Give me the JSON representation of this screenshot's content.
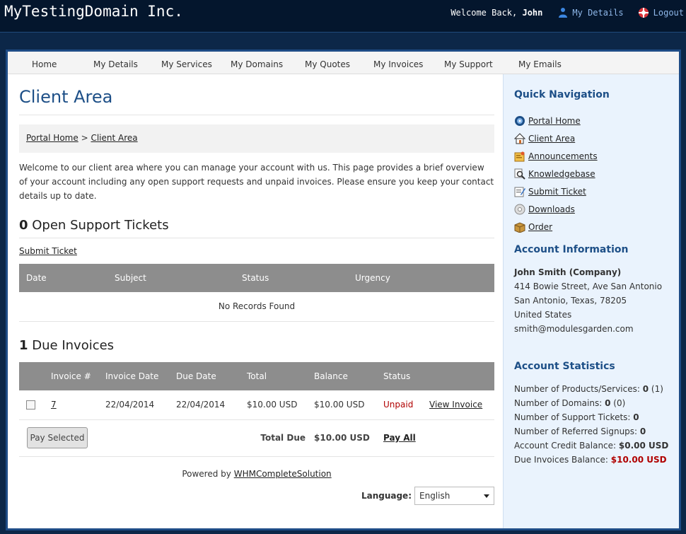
{
  "header": {
    "brand": "MyTestingDomain Inc.",
    "welcome_prefix": "Welcome Back, ",
    "welcome_name": "John",
    "my_details": "My Details",
    "logout": "Logout"
  },
  "nav": [
    "Home",
    "My Details",
    "My Services",
    "My Domains",
    "My Quotes",
    "My Invoices",
    "My Support",
    "My Emails"
  ],
  "page": {
    "title": "Client Area",
    "breadcrumb": {
      "home": "Portal Home",
      "sep": ">",
      "current": "Client Area"
    },
    "intro": "Welcome to our client area where you can manage your account with us. This page provides a brief overview of your account including any open support requests and unpaid invoices. Please ensure you keep your contact details up to date."
  },
  "tickets": {
    "count": "0",
    "title": "Open Support Tickets",
    "submit_link": "Submit Ticket",
    "columns": [
      "Date",
      "Subject",
      "Status",
      "Urgency"
    ],
    "empty": "No Records Found"
  },
  "invoices": {
    "count": "1",
    "title": "Due Invoices",
    "columns": [
      "Invoice #",
      "Invoice Date",
      "Due Date",
      "Total",
      "Balance",
      "Status"
    ],
    "rows": [
      {
        "number": "7",
        "invoice_date": "22/04/2014",
        "due_date": "22/04/2014",
        "total": "$10.00 USD",
        "balance": "$10.00 USD",
        "status": "Unpaid",
        "action": "View Invoice"
      }
    ],
    "pay_selected": "Pay Selected",
    "total_due_label": "Total Due",
    "total_due": "$10.00 USD",
    "pay_all": "Pay All"
  },
  "footer": {
    "powered_prefix": "Powered by ",
    "powered_link": "WHMCompleteSolution",
    "language_label": "Language:",
    "language_value": "English"
  },
  "sidebar": {
    "quick_nav_title": "Quick Navigation",
    "quick_nav": [
      "Portal Home",
      "Client Area",
      "Announcements",
      "Knowledgebase",
      "Submit Ticket",
      "Downloads",
      "Order"
    ],
    "account_title": "Account Information",
    "account": {
      "name": "John Smith (Company)",
      "address1": "414 Bowie Street, Ave San Antonio",
      "address2": "San Antonio, Texas, 78205",
      "country": "United States",
      "email": "smith@modulesgarden.com"
    },
    "stats_title": "Account Statistics",
    "stats": {
      "products_label": "Number of Products/Services:",
      "products_value": "0",
      "products_extra": "(1)",
      "domains_label": "Number of Domains:",
      "domains_value": "0",
      "domains_extra": "(0)",
      "tickets_label": "Number of Support Tickets:",
      "tickets_value": "0",
      "referred_label": "Number of Referred Signups:",
      "referred_value": "0",
      "credit_label": "Account Credit Balance:",
      "credit_value": "$0.00 USD",
      "due_label": "Due Invoices Balance:",
      "due_value": "$10.00 USD"
    }
  }
}
